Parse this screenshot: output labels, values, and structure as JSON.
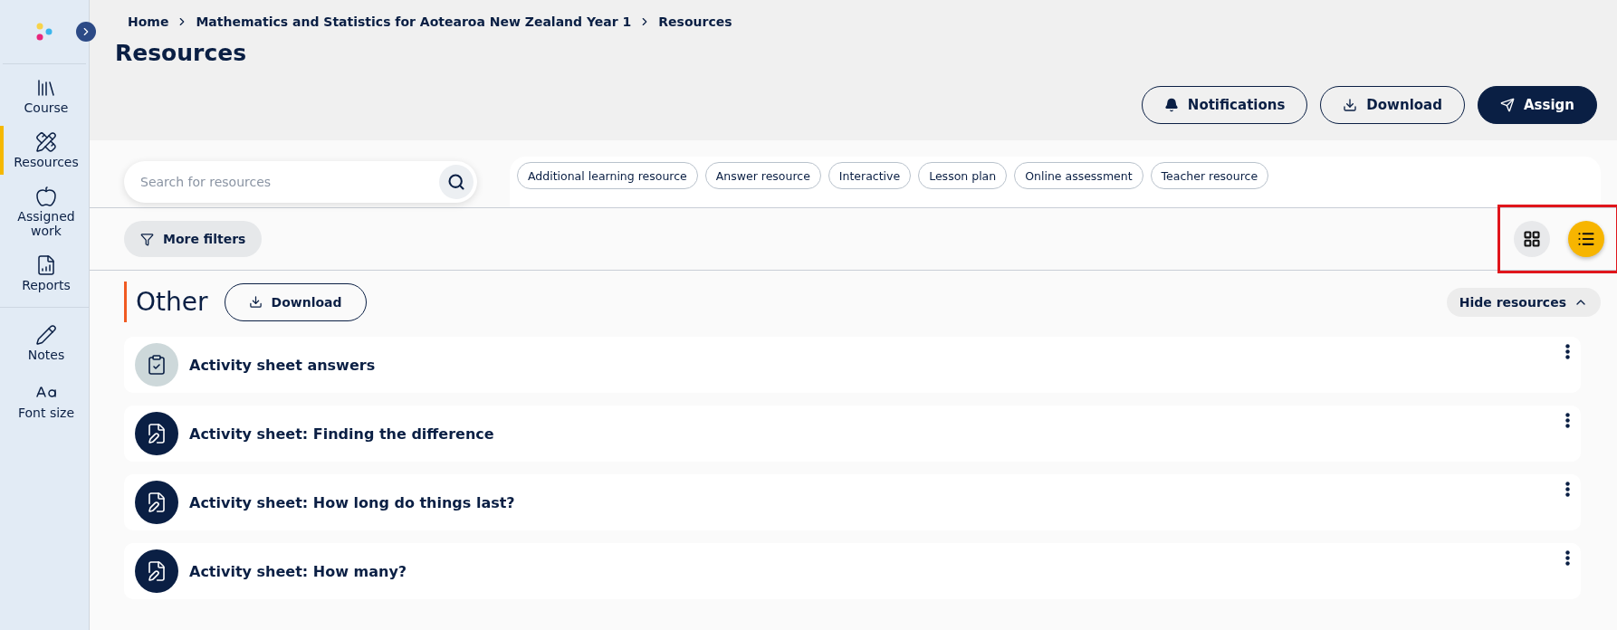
{
  "sidebar": {
    "items": [
      {
        "label": "Course",
        "selected": false
      },
      {
        "label": "Resources",
        "selected": true
      },
      {
        "label": "Assigned work",
        "selected": false
      },
      {
        "label": "Reports",
        "selected": false
      }
    ],
    "tools": [
      {
        "label": "Notes"
      },
      {
        "label": "Font size"
      }
    ]
  },
  "breadcrumb": [
    "Home",
    "Mathematics and Statistics for Aotearoa New Zealand Year 1",
    "Resources"
  ],
  "title": "Resources",
  "actions": [
    {
      "label": "Notifications",
      "primary": false
    },
    {
      "label": "Download",
      "primary": false
    },
    {
      "label": "Assign",
      "primary": true
    }
  ],
  "search": {
    "placeholder": "Search for resources"
  },
  "chips": [
    "Additional learning resource",
    "Answer resource",
    "Interactive",
    "Lesson plan",
    "Online assessment",
    "Teacher resource"
  ],
  "more_filters": "More filters",
  "views": [
    {
      "kind": "grid",
      "selected": false
    },
    {
      "kind": "list",
      "selected": true
    }
  ],
  "section": {
    "title": "Other",
    "download": "Download",
    "toggle": "Hide resources",
    "expanded": true
  },
  "items": [
    {
      "kind": "answers",
      "title": "Activity sheet answers"
    },
    {
      "kind": "sheet",
      "title": "Activity sheet: Finding the difference"
    },
    {
      "kind": "sheet",
      "title": "Activity sheet: How long do things last?"
    },
    {
      "kind": "sheet",
      "title": "Activity sheet: How many?"
    }
  ]
}
